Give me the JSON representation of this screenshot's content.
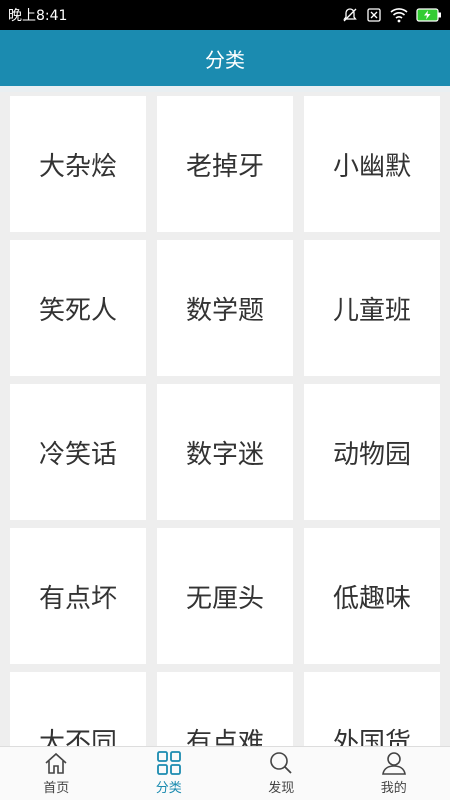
{
  "status_bar": {
    "time": "晚上8:41"
  },
  "header": {
    "title": "分类"
  },
  "categories": [
    "大杂烩",
    "老掉牙",
    "小幽默",
    "笑死人",
    "数学题",
    "儿童班",
    "冷笑话",
    "数字迷",
    "动物园",
    "有点坏",
    "无厘头",
    "低趣味",
    "大不同",
    "有点难",
    "外国货"
  ],
  "tabs": [
    {
      "label": "首页",
      "icon": "home-icon"
    },
    {
      "label": "分类",
      "icon": "grid-icon",
      "active": true
    },
    {
      "label": "发现",
      "icon": "search-icon"
    },
    {
      "label": "我的",
      "icon": "user-icon"
    }
  ],
  "colors": {
    "accent": "#1b8bb0",
    "header_bg": "#1b8bb0",
    "battery": "#33cc33"
  }
}
